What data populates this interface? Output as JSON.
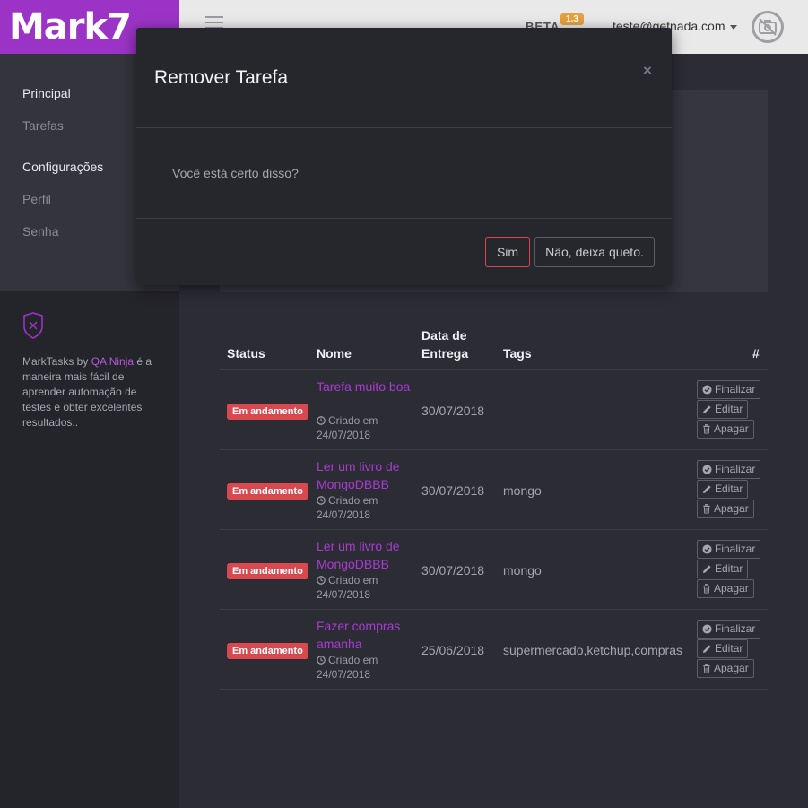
{
  "brand": {
    "logo_text": "Mark7",
    "color": "#9b34c6"
  },
  "topbar": {
    "menu_icon": "hamburger-icon",
    "beta_label": "BETA",
    "version": "1.3",
    "user_email": "teste@getnada.com",
    "avatar_icon": "no-photo-icon"
  },
  "sidebar": {
    "items": [
      {
        "label": "Principal",
        "type": "heading"
      },
      {
        "label": "Tarefas",
        "type": "link"
      },
      {
        "label": "Configurações",
        "type": "heading"
      },
      {
        "label": "Perfil",
        "type": "link"
      },
      {
        "label": "Senha",
        "type": "link"
      }
    ],
    "about": {
      "icon": "shield-icon",
      "prefix": "MarkTasks by ",
      "link": "QA Ninja",
      "suffix": " é a maneira mais fácil de aprender automação de testes e obter excelentes resultados.."
    }
  },
  "table": {
    "headers": {
      "status": "Status",
      "name": "Nome",
      "due": "Data de Entrega",
      "tags": "Tags",
      "actions": "#"
    },
    "rows": [
      {
        "status": "Em andamento",
        "name": "Tarefa muito boa",
        "created": "Criado em 24/07/2018",
        "due": "30/07/2018",
        "tags": ""
      },
      {
        "status": "Em andamento",
        "name": "Ler um livro de MongoDBBB",
        "created": "Criado em 24/07/2018",
        "due": "30/07/2018",
        "tags": "mongo"
      },
      {
        "status": "Em andamento",
        "name": "Ler um livro de MongoDBBB",
        "created": "Criado em 24/07/2018",
        "due": "30/07/2018",
        "tags": "mongo"
      },
      {
        "status": "Em andamento",
        "name": "Fazer compras amanha",
        "created": "Criado em 24/07/2018",
        "due": "25/06/2018",
        "tags": "supermercado,ketchup,compras"
      }
    ],
    "actions": {
      "finish": "Finalizar",
      "edit": "Editar",
      "delete": "Apagar"
    }
  },
  "modal": {
    "title": "Remover Tarefa",
    "close_label": "×",
    "message": "Você está certo disso?",
    "confirm_label": "Sim",
    "cancel_label": "Não, deixa queto."
  },
  "colors": {
    "accent": "#a93bd0",
    "danger": "#d9484f",
    "badge_warning": "#e6a13c"
  }
}
